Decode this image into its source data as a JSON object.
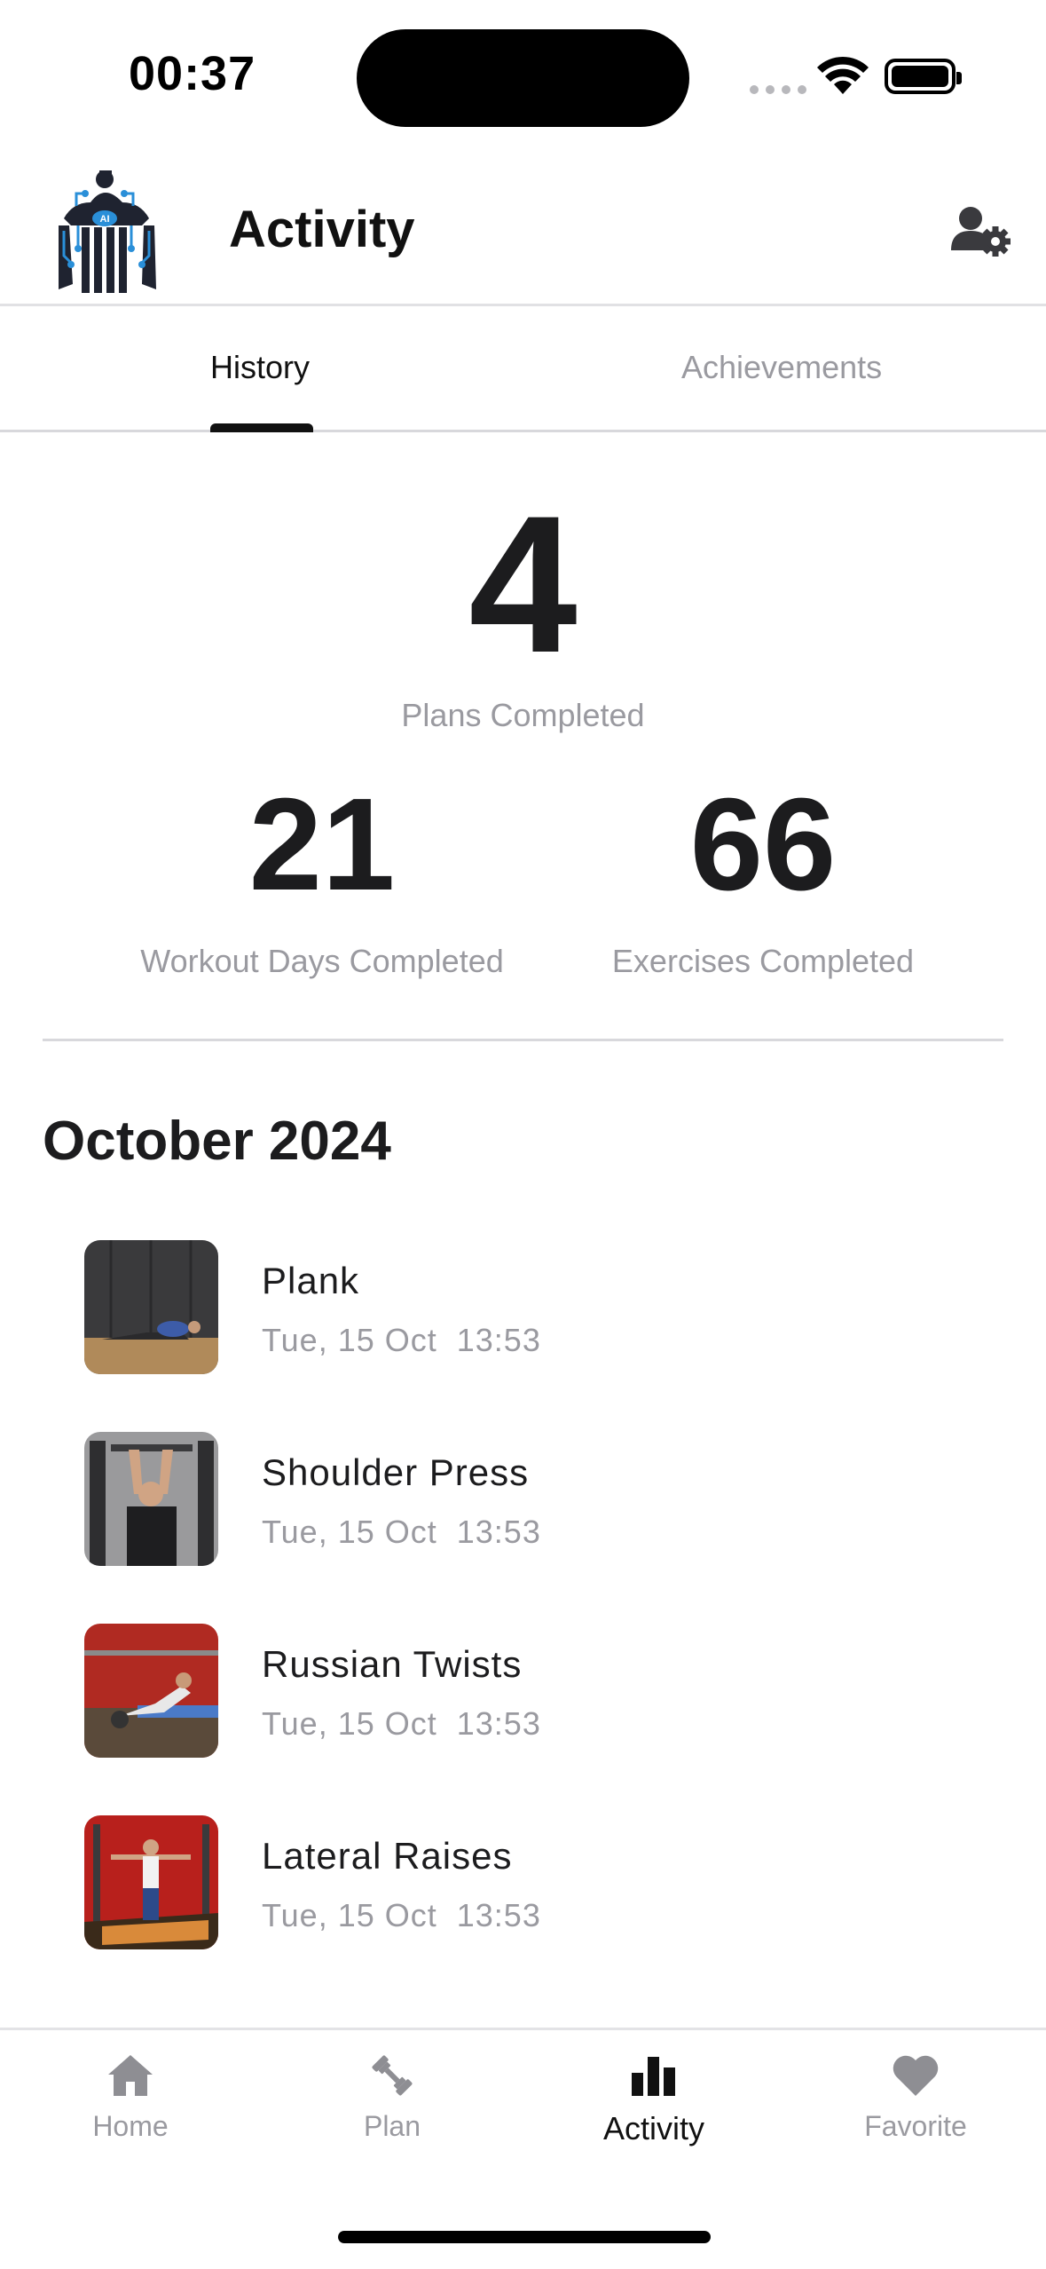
{
  "status_bar": {
    "time": "00:37"
  },
  "header": {
    "title": "Activity"
  },
  "tabs": [
    {
      "label": "History",
      "active": true
    },
    {
      "label": "Achievements",
      "active": false
    }
  ],
  "stats": {
    "plans_completed": {
      "value": "4",
      "label": "Plans Completed"
    },
    "workout_days": {
      "value": "21",
      "label": "Workout Days Completed"
    },
    "exercises": {
      "value": "66",
      "label": "Exercises Completed"
    }
  },
  "history": {
    "month": "October 2024",
    "items": [
      {
        "name": "Plank",
        "date": "Tue, 15 Oct  13:53"
      },
      {
        "name": "Shoulder Press",
        "date": "Tue, 15 Oct  13:53"
      },
      {
        "name": "Russian Twists",
        "date": "Tue, 15 Oct  13:53"
      },
      {
        "name": "Lateral Raises",
        "date": "Tue, 15 Oct  13:53"
      }
    ]
  },
  "nav": [
    {
      "label": "Home",
      "icon": "home-icon"
    },
    {
      "label": "Plan",
      "icon": "dumbbell-icon"
    },
    {
      "label": "Activity",
      "icon": "bar-chart-icon",
      "active": true
    },
    {
      "label": "Favorite",
      "icon": "heart-icon"
    }
  ],
  "colors": {
    "text": "#1c1c1e",
    "muted": "#9a9aa0",
    "logo_blue": "#2a8fd8",
    "divider": "#d8d8dc"
  }
}
